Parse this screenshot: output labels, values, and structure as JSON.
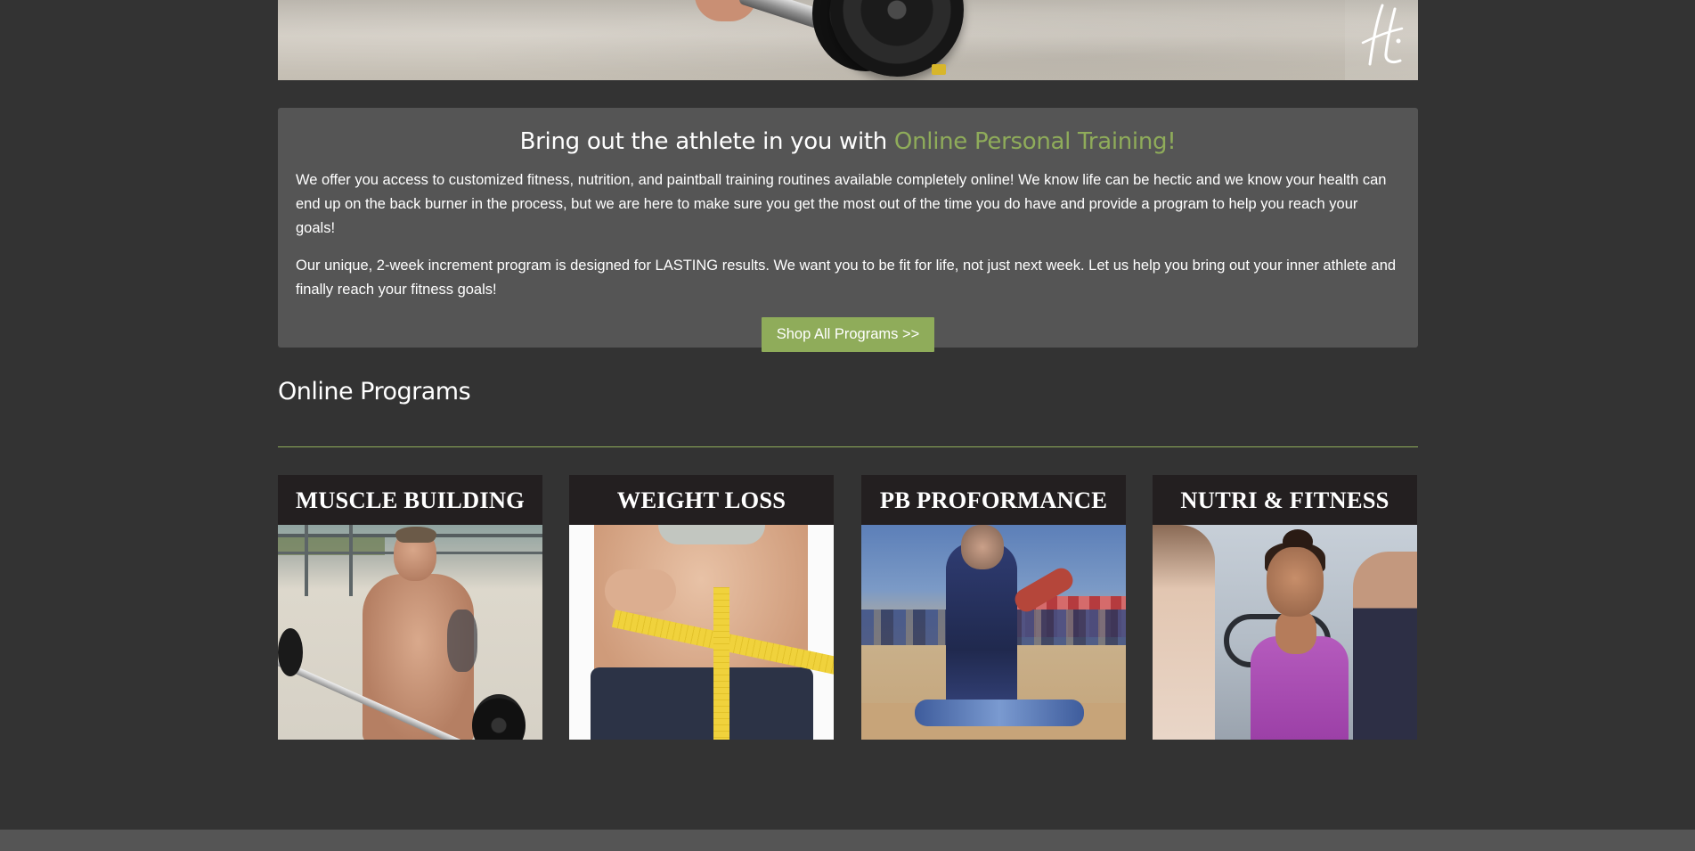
{
  "hero": {
    "image_alt": "athlete lifting barbell",
    "logo_icon": "brand-logo-icon"
  },
  "intro": {
    "heading_prefix": "Bring out the athlete in you with ",
    "heading_accent": "Online Personal Training!",
    "paragraph_1": "We offer you access to customized fitness, nutrition, and paintball training routines available completely online! We know life can be hectic and we know your health can end up on the back burner in the process, but we are here to make sure you get the most out of the time you do have and provide a program to help you reach your goals!",
    "paragraph_2": "Our unique, 2-week increment program is designed for LASTING results. We want you to be fit for life, not just next week. Let us help you bring out your inner athlete and finally reach your fitness goals!",
    "button_label": "Shop All Programs >>"
  },
  "programs": {
    "section_title": "Online Programs",
    "items": [
      {
        "title": "MUSCLE BUILDING"
      },
      {
        "title": "WEIGHT LOSS"
      },
      {
        "title": "PB PROFORMANCE"
      },
      {
        "title": "NUTRI & FITNESS"
      }
    ]
  },
  "colors": {
    "background": "#333333",
    "panel": "#555555",
    "accent": "#8fac5a",
    "card_header": "#231f20"
  }
}
